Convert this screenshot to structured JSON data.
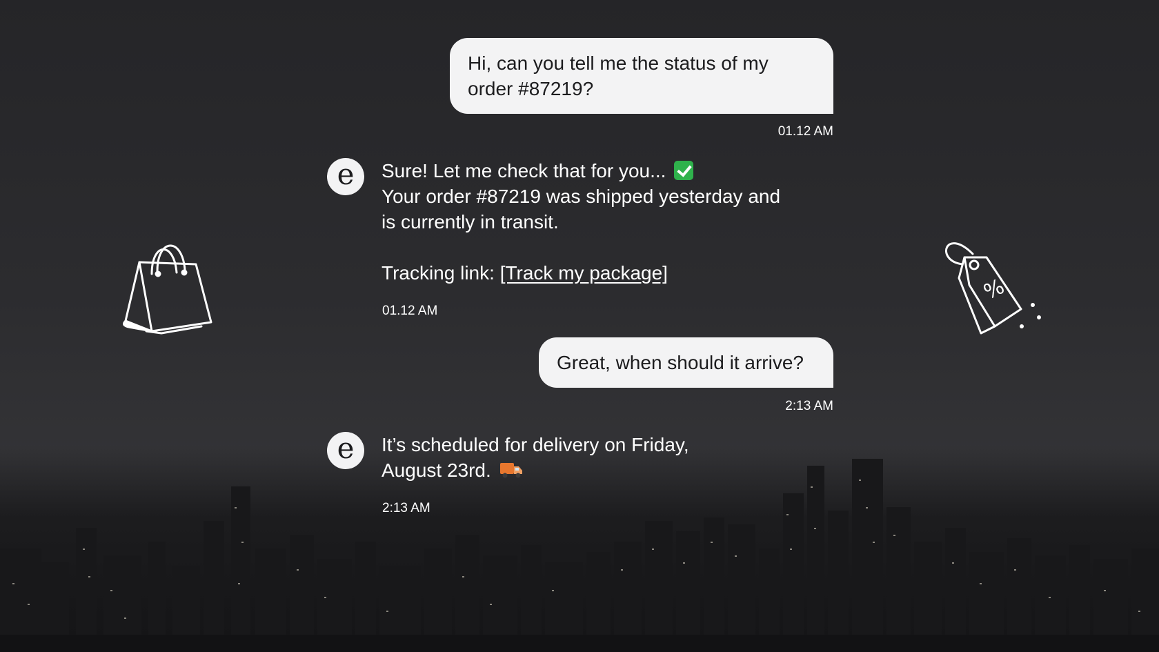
{
  "conversation": {
    "messages": [
      {
        "sender": "user",
        "lines": [
          "Hi, can you tell me the status of my",
          "order #87219?"
        ],
        "time": "01.12 AM"
      },
      {
        "sender": "bot",
        "avatar_letter": "e",
        "lines": [
          "Sure! Let me check that for you...",
          "Your order #87219 was shipped yesterday and",
          "is currently in transit."
        ],
        "tracking_prefix": "Tracking link: ",
        "tracking_link": "[Track my package]",
        "emoji": "check-mark-icon",
        "time": "01.12 AM"
      },
      {
        "sender": "user",
        "lines": [
          "Great, when should it arrive?"
        ],
        "time": "2:13 AM"
      },
      {
        "sender": "bot",
        "avatar_letter": "e",
        "lines": [
          "It’s scheduled for delivery on Friday,",
          "August 23rd."
        ],
        "emoji": "delivery-truck-icon",
        "time": "2:13 AM"
      }
    ]
  },
  "decorations": {
    "left": "shopping-bag-icon",
    "right": "discount-tag-icon"
  },
  "colors": {
    "background": "#2a2a2d",
    "user_bubble": "#f3f3f4",
    "user_text": "#1c1c1e",
    "bot_text": "#ffffff",
    "check_emoji": "#2fb24c",
    "truck_emoji": "#e8772e"
  }
}
